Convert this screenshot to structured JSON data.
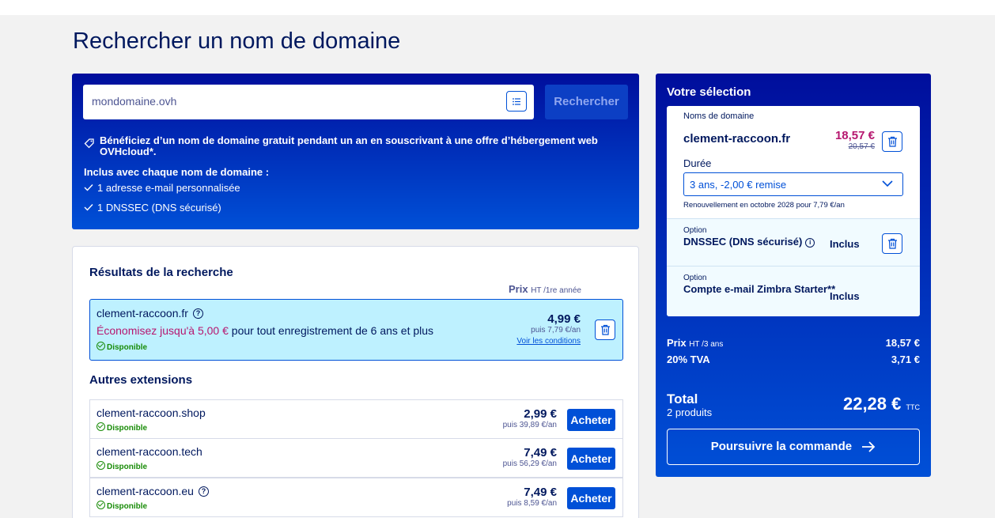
{
  "page": {
    "title": "Rechercher un nom de domaine"
  },
  "search": {
    "value": "mondomaine.ovh",
    "button_label": "Rechercher",
    "promo_text": "Bénéficiez d’un nom de domaine gratuit pendant un an en souscrivant à une offre d’hébergement web OVHcloud*.",
    "included_title": "Inclus avec chaque nom de domaine :",
    "included_items": [
      "1 adresse e-mail personnalisée",
      "1 DNSSEC (DNS sécurisé)"
    ]
  },
  "results": {
    "title": "Résultats de la recherche",
    "price_head": "Prix",
    "price_head_suffix": "HT /1re année",
    "main": {
      "domain": "clement-raccoon.fr",
      "promo_highlight": "Économisez jusqu'à 5,00 €",
      "promo_rest": " pour tout enregistrement de 6 ans et plus",
      "status": "Disponible",
      "price": "4,99 €",
      "renewal": "puis 7,79 €/an",
      "conditions_link": "Voir les conditions"
    },
    "other_title": "Autres extensions",
    "others": [
      {
        "domain": "clement-raccoon.shop",
        "status": "Disponible",
        "price": "2,99 €",
        "renewal": "puis 39,89 €/an",
        "buy_label": "Acheter"
      },
      {
        "domain": "clement-raccoon.tech",
        "status": "Disponible",
        "price": "7,49 €",
        "renewal": "puis 56,29 €/an",
        "buy_label": "Acheter"
      },
      {
        "domain": "clement-raccoon.eu",
        "status": "Disponible",
        "price": "7,49 €",
        "renewal": "puis 8,59 €/an",
        "buy_label": "Acheter"
      }
    ]
  },
  "selection": {
    "title": "Votre sélection",
    "domain_section_label": "Noms de domaine",
    "domain": "clement-raccoon.fr",
    "price": "18,57 €",
    "old_price": "20,57 €",
    "duration_label": "Durée",
    "duration_value": "3 ans, -2,00 € remise",
    "renewal_note": "Renouvellement en octobre 2028 pour 7,79 €/an",
    "options": [
      {
        "label": "Option",
        "name": "DNSSEC (DNS sécurisé)",
        "status": "Inclus"
      },
      {
        "label": "Option",
        "name": "Compte e-mail Zimbra Starter**",
        "status": "Inclus"
      }
    ],
    "price_row_label": "Prix",
    "price_row_suffix": "HT /3 ans",
    "price_row_value": "18,57 €",
    "tva_label": "20% TVA",
    "tva_value": "3,71 €",
    "total_label": "Total",
    "total_sub": "2 produits",
    "total_value": "22,28 €",
    "total_suffix": "TTC",
    "continue_label": "Poursuivre la commande"
  }
}
